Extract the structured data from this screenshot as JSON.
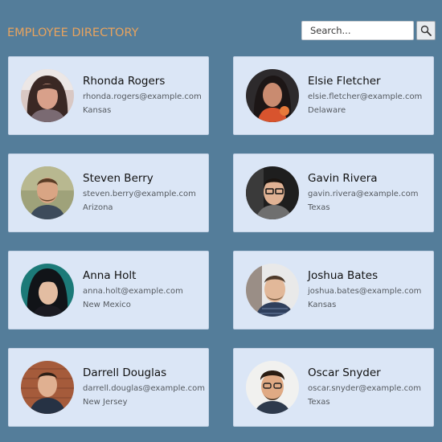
{
  "header": {
    "title": "EMPLOYEE DIRECTORY"
  },
  "search": {
    "placeholder": "Search...",
    "button_icon": "search-icon"
  },
  "employees": [
    {
      "name": "Rhonda Rogers",
      "email": "rhonda.rogers@example.com",
      "location": "Kansas"
    },
    {
      "name": "Elsie Fletcher",
      "email": "elsie.fletcher@example.com",
      "location": "Delaware"
    },
    {
      "name": "Steven Berry",
      "email": "steven.berry@example.com",
      "location": "Arizona"
    },
    {
      "name": "Gavin Rivera",
      "email": "gavin.rivera@example.com",
      "location": "Texas"
    },
    {
      "name": "Anna Holt",
      "email": "anna.holt@example.com",
      "location": "New Mexico"
    },
    {
      "name": "Joshua Bates",
      "email": "joshua.bates@example.com",
      "location": "Kansas"
    },
    {
      "name": "Darrell Douglas",
      "email": "darrell.douglas@example.com",
      "location": "New Jersey"
    },
    {
      "name": "Oscar Snyder",
      "email": "oscar.snyder@example.com",
      "location": "Texas"
    }
  ],
  "colors": {
    "background": "#547d9a",
    "title": "#e8a35e",
    "card": "#dbe6f6"
  }
}
